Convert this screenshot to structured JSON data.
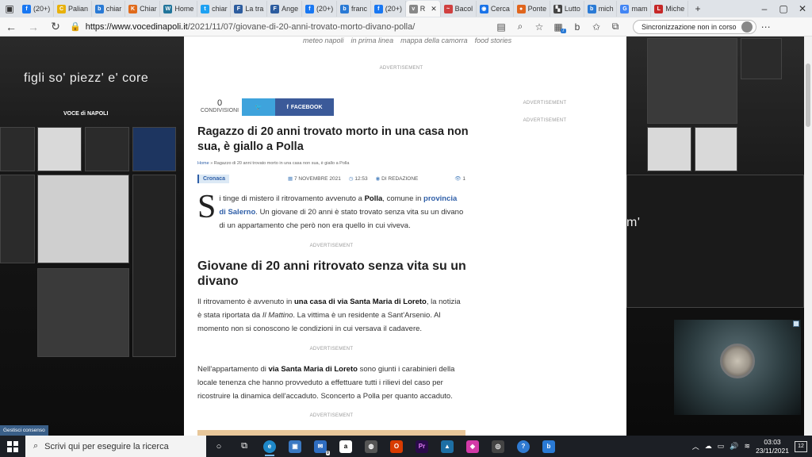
{
  "browser": {
    "tabs": [
      {
        "label": "(20+)",
        "icon": "facebook-icon",
        "color": "#1877f2",
        "glyph": "f"
      },
      {
        "label": "Palian",
        "icon": "c-icon",
        "color": "#e8b10b",
        "glyph": "C"
      },
      {
        "label": "chiar",
        "icon": "bing-icon",
        "color": "#2a7ad5",
        "glyph": "b"
      },
      {
        "label": "Chiar",
        "icon": "k-icon",
        "color": "#e06b1c",
        "glyph": "K"
      },
      {
        "label": "Home",
        "icon": "wordpress-icon",
        "color": "#21759b",
        "glyph": "W"
      },
      {
        "label": "chiar",
        "icon": "twitter-icon",
        "color": "#1da1f2",
        "glyph": "t"
      },
      {
        "label": "La tra",
        "icon": "f-icon",
        "color": "#2d5d9f",
        "glyph": "F"
      },
      {
        "label": "Ange",
        "icon": "f-icon",
        "color": "#2d5d9f",
        "glyph": "F"
      },
      {
        "label": "(20+)",
        "icon": "facebook-icon",
        "color": "#1877f2",
        "glyph": "f"
      },
      {
        "label": "franc",
        "icon": "bing-icon",
        "color": "#2a7ad5",
        "glyph": "b"
      },
      {
        "label": "(20+)",
        "icon": "facebook-icon",
        "color": "#1877f2",
        "glyph": "f"
      },
      {
        "label": "R",
        "icon": "vdn-icon",
        "color": "#888888",
        "glyph": "v",
        "active": true
      },
      {
        "label": "Bacol",
        "icon": "rainbow-icon",
        "color": "#d04040",
        "glyph": "~"
      },
      {
        "label": "Cerca",
        "icon": "maps-icon",
        "color": "#1a73e8",
        "glyph": "◉"
      },
      {
        "label": "Ponte",
        "icon": "orange-icon",
        "color": "#e0651d",
        "glyph": "●"
      },
      {
        "label": "Lutto",
        "icon": "bookmark-icon",
        "color": "#444444",
        "glyph": "▚"
      },
      {
        "label": "mich",
        "icon": "bing-icon",
        "color": "#2a7ad5",
        "glyph": "b"
      },
      {
        "label": "mam",
        "icon": "google-icon",
        "color": "#4285f4",
        "glyph": "G"
      },
      {
        "label": "Miche",
        "icon": "l-icon",
        "color": "#c62828",
        "glyph": "L"
      }
    ],
    "new_tab": "+",
    "url_host": "https://www.vocedinapoli.it",
    "url_path": "/2021/11/07/giovane-di-20-anni-trovato-morto-divano-polla/",
    "sync_label": "Sincronizzazione non in corso",
    "extension_badge": "7"
  },
  "site": {
    "submenu": [
      "meteo napoli",
      "in prima linea",
      "mappa della camorra",
      "food stories"
    ],
    "ad_label": "ADVERTISEMENT",
    "share_count": "0",
    "share_label": "CONDIVISIONI",
    "facebook_label": "FACEBOOK",
    "bg_quote_left": "figli so' piezz' e' core",
    "bg_logo": "VOCE di NAPOLI",
    "bg_quote_right": "m'",
    "consent_label": "Gestisci consenso"
  },
  "article": {
    "title": "Ragazzo di 20 anni trovato morto in una casa non sua, è giallo a Polla",
    "breadcrumb_home": "Home",
    "breadcrumb_rest": "Ragazzo di 20 anni trovato morto in una casa non sua, è giallo a Polla",
    "category": "Cronaca",
    "date": "7 NOVEMBRE 2021",
    "time": "12:53",
    "author": "DI REDAZIONE",
    "views": "1",
    "p1_dropcap": "S",
    "p1_a": "i tinge di mistero il ritrovamento avvenuto a ",
    "p1_polla": "Polla",
    "p1_b": ", comune in ",
    "p1_link": "provincia di Salerno",
    "p1_c": ". Un giovane di 20 anni è stato trovato senza vita su un divano di un appartamento che però non era quello in cui viveva.",
    "subhead": "Giovane di 20 anni ritrovato senza vita su un divano",
    "p2_a": "Il ritrovamento è avvenuto in ",
    "p2_b": "una casa di via Santa Maria di Loreto",
    "p2_c": ", la notizia è stata riportata da ",
    "p2_d": "Il Mattino",
    "p2_e": ". La vittima è un residente a Sant'Arsenio. Al momento non si conoscono le condizioni in cui versava il cadavere.",
    "p3_a": "Nell'appartamento di ",
    "p3_b": "via Santa Maria di Loreto",
    "p3_c": " sono giunti i carabinieri della locale tenenza che hanno provveduto a effettuare tutti i rilievi del caso per ricostruire la dinamica dell'accaduto. Sconcerto a Polla per quanto accaduto."
  },
  "taskbar": {
    "search_placeholder": "Scrivi qui per eseguire la ricerca",
    "time": "03:03",
    "date": "23/11/2021",
    "notifications": "12",
    "mail_badge": "8"
  }
}
